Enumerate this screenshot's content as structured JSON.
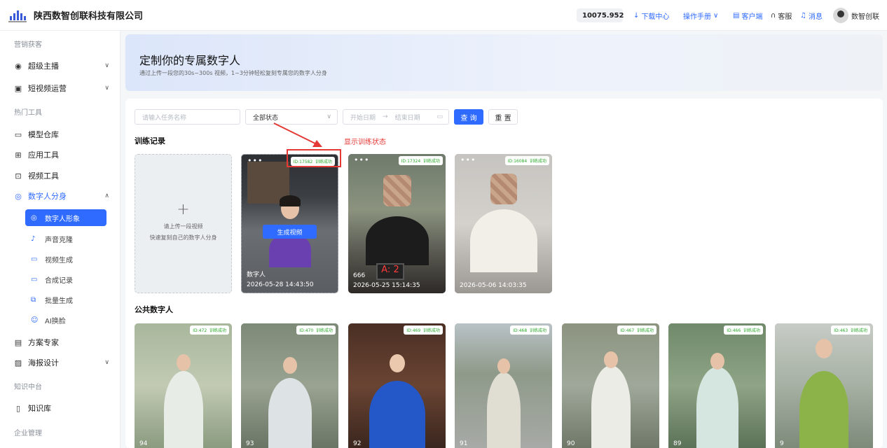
{
  "header": {
    "company": "陕西数智创联科技有限公司",
    "credit": "10075.952",
    "download": "下载中心",
    "manual": "操作手册",
    "client": "客户端",
    "service": "客服",
    "messages": "消息",
    "username": "数智创联"
  },
  "sidebar": {
    "sec1": "营销获客",
    "item_anchor": "超级主播",
    "item_shortvideo": "短视频运营",
    "sec2": "热门工具",
    "item_model": "模型仓库",
    "item_apps": "应用工具",
    "item_video": "视频工具",
    "item_digital": "数字人分身",
    "sub_image": "数字人形象",
    "sub_voice": "声音克隆",
    "sub_vgen": "视频生成",
    "sub_records": "合成记录",
    "sub_batch": "批量生成",
    "sub_face": "AI换脸",
    "item_plan": "方案专家",
    "item_poster": "海报设计",
    "sec3": "知识中台",
    "item_kb": "知识库",
    "sec4": "企业管理"
  },
  "banner": {
    "title": "定制你的专属数字人",
    "subtitle": "通过上传一段您的30s~300s 视频，1~3分钟轻松复刻专属您的数字人分身"
  },
  "filters": {
    "task_placeholder": "请输入任务名称",
    "status": "全部状态",
    "start": "开始日期",
    "arrow": "→",
    "end": "结束日期",
    "query": "查 询",
    "reset": "重 置"
  },
  "training": {
    "title": "训练记录",
    "annotation": "显示训练状态",
    "upload_line1": "请上传一段视频",
    "upload_line2": "快速复刻自己的数字人分身",
    "generate": "生成视频",
    "cards": [
      {
        "id": "ID:17582",
        "status": "训练成功",
        "name": "数字人",
        "date": "2026-05-28 14:43:50"
      },
      {
        "id": "ID:17324",
        "status": "训练成功",
        "name": "666",
        "date": "2026-05-25 15:14:35"
      },
      {
        "id": "ID:16084",
        "status": "训练成功",
        "name": "",
        "date": "2026-05-06 14:03:35"
      }
    ]
  },
  "public": {
    "title": "公共数字人",
    "cards": [
      {
        "id": "ID:472",
        "status": "训练成功",
        "name": "94"
      },
      {
        "id": "ID:470",
        "status": "训练成功",
        "name": "93"
      },
      {
        "id": "ID:469",
        "status": "训练成功",
        "name": "92"
      },
      {
        "id": "ID:468",
        "status": "训练成功",
        "name": "91"
      },
      {
        "id": "ID:467",
        "status": "训练成功",
        "name": "90"
      },
      {
        "id": "ID:466",
        "status": "训练成功",
        "name": "89"
      },
      {
        "id": "ID:463",
        "status": "训练成功",
        "name": "9"
      }
    ]
  },
  "icons": [
    "logo-icon",
    "coin-icon",
    "download-icon",
    "chevron-down-icon",
    "client-icon",
    "headset-icon",
    "bell-icon",
    "robot-icon",
    "play-icon",
    "grid-icon",
    "video-icon",
    "digital-human-icon",
    "mic-icon",
    "camera-icon",
    "batch-icon",
    "face-icon",
    "document-icon",
    "poster-icon",
    "book-icon",
    "calendar-icon",
    "plus-icon"
  ],
  "colors": {
    "accent": "#2f6bff",
    "success": "#29a829",
    "annotation": "#e53935",
    "credit": "#a9216f"
  }
}
